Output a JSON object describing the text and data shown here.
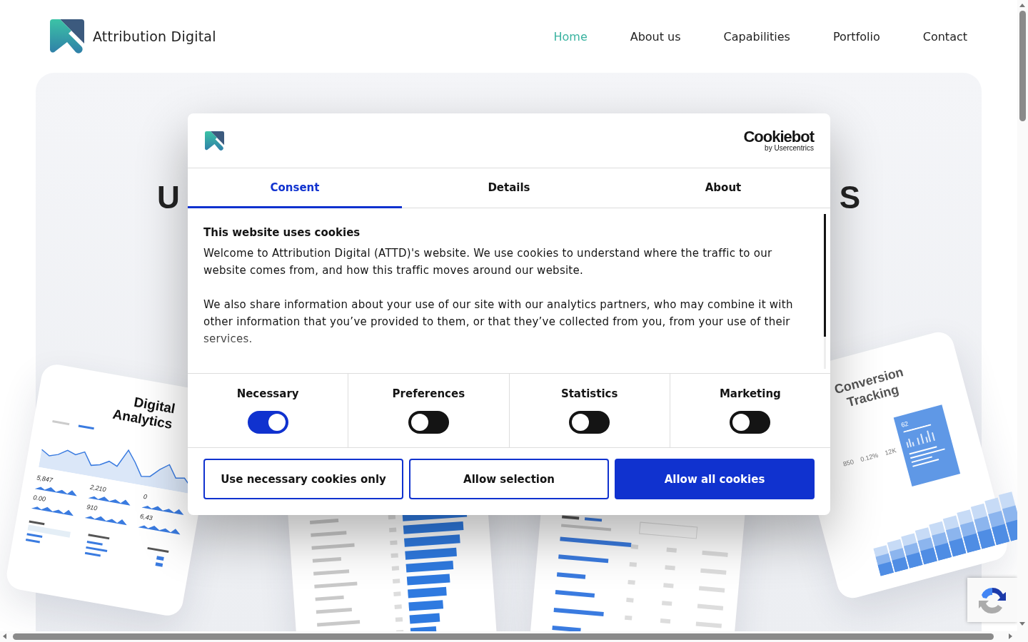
{
  "header": {
    "logo_text": "Attribution Digital",
    "nav": [
      {
        "label": "Home",
        "selected": true
      },
      {
        "label": "About us",
        "selected": false
      },
      {
        "label": "Capabilities",
        "selected": false
      },
      {
        "label": "Portfolio",
        "selected": false
      },
      {
        "label": "Contact",
        "selected": false
      }
    ]
  },
  "hero": {
    "heading_fragments": [
      "U",
      "S"
    ],
    "cards": [
      {
        "kind": "analytics",
        "title": "Digital Analytics",
        "figures": [
          "5,847",
          "2,210",
          "0",
          "0.00",
          "910",
          "6,43"
        ]
      },
      {
        "kind": "bars"
      },
      {
        "kind": "table"
      },
      {
        "kind": "conversion",
        "title": "Conversion Tracking",
        "figures": [
          "850",
          "0.12%",
          "12K",
          "62"
        ]
      }
    ]
  },
  "dialog": {
    "brand": "Cookiebot",
    "brand_sub": "by Usercentrics",
    "tabs": [
      {
        "label": "Consent",
        "selected": true
      },
      {
        "label": "Details",
        "selected": false
      },
      {
        "label": "About",
        "selected": false
      }
    ],
    "title": "This website uses cookies",
    "paragraphs": [
      "Welcome to Attribution Digital (ATTD)'s website. We use cookies to understand where the traffic to our website comes from, and how this traffic moves around our website.",
      "We also share information about your use of our site with our analytics partners, who may combine it with other information that you’ve provided to them, or that they’ve collected from you, from your use of their services."
    ],
    "categories": [
      {
        "label": "Necessary",
        "checked": true
      },
      {
        "label": "Preferences",
        "checked": false
      },
      {
        "label": "Statistics",
        "checked": false
      },
      {
        "label": "Marketing",
        "checked": false
      }
    ],
    "buttons": [
      {
        "label": "Use necessary cookies only",
        "kind": "outline"
      },
      {
        "label": "Allow selection",
        "kind": "outline"
      },
      {
        "label": "Allow all cookies",
        "kind": "primary"
      }
    ]
  }
}
